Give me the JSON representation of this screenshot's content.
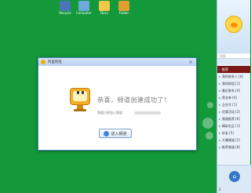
{
  "desktop": {
    "icons": [
      {
        "label": "Recycle",
        "color": "#4a76b8"
      },
      {
        "label": "Computer",
        "color": "#6ea8dc"
      },
      {
        "label": "Docs",
        "color": "#f0c84a"
      },
      {
        "label": "Folder",
        "color": "#e0a030"
      }
    ]
  },
  "dialog": {
    "title": "阿里旺旺",
    "close": "×",
    "headline": "恭喜，频道创建成功了！",
    "subline": "频道已经加入频道",
    "enter_button": "进入频道"
  },
  "panel": {
    "search_placeholder": "搜索",
    "items": [
      "我的联系人 [6]",
      "我的群组 [1]",
      "最近联系 [0]",
      "黑名单 [0]",
      "企业号 [1]",
      "优惠活动 [2]",
      "频道推荐 [6]",
      "精彩社区 [1]",
      "好友 [5]",
      "大嘴频道 [2]",
      "推荐频道 [8]"
    ],
    "banner_item": "推荐",
    "bottom_label": "2",
    "home_icon": "⌂"
  }
}
